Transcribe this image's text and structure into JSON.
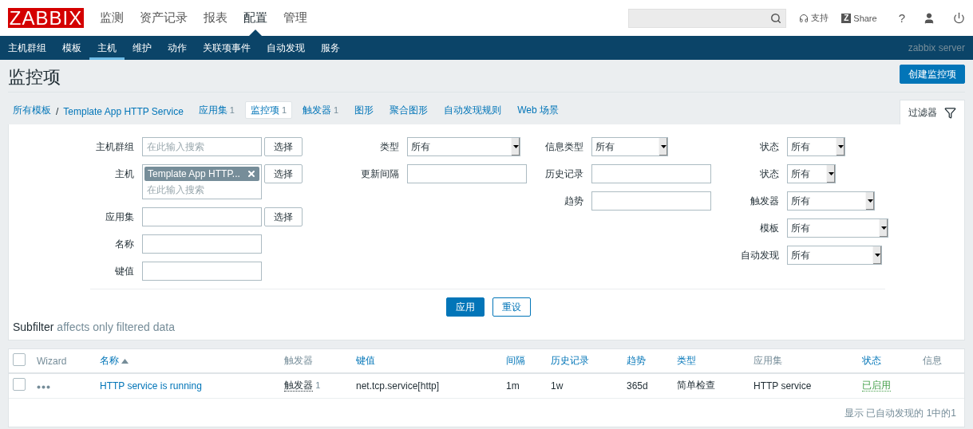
{
  "header": {
    "logo": "ZABBIX",
    "main_menu": [
      {
        "label": "监测",
        "selected": false
      },
      {
        "label": "资产记录",
        "selected": false
      },
      {
        "label": "报表",
        "selected": false
      },
      {
        "label": "配置",
        "selected": true
      },
      {
        "label": "管理",
        "selected": false
      }
    ],
    "support": "支持",
    "share": {
      "mark": "Z",
      "label": "Share"
    },
    "help": "?"
  },
  "sub_menu": {
    "items": [
      {
        "label": "主机群组",
        "selected": false
      },
      {
        "label": "模板",
        "selected": false
      },
      {
        "label": "主机",
        "selected": true
      },
      {
        "label": "维护",
        "selected": false
      },
      {
        "label": "动作",
        "selected": false
      },
      {
        "label": "关联项事件",
        "selected": false
      },
      {
        "label": "自动发现",
        "selected": false
      },
      {
        "label": "服务",
        "selected": false
      }
    ],
    "server": "zabbix server"
  },
  "page": {
    "title": "监控项",
    "create_button": "创建监控项"
  },
  "breadcrumbs": [
    "所有模板",
    "Template App HTTP Service"
  ],
  "breadcrumb_separator": "/",
  "tabs": [
    {
      "label": "应用集",
      "count": "1",
      "selected": false
    },
    {
      "label": "监控项",
      "count": "1",
      "selected": true
    },
    {
      "label": "触发器",
      "count": "1",
      "selected": false
    },
    {
      "label": "图形",
      "selected": false
    },
    {
      "label": "聚合图形",
      "selected": false
    },
    {
      "label": "自动发现规则",
      "selected": false
    },
    {
      "label": "Web 场景",
      "selected": false
    }
  ],
  "filter": {
    "tab": "过滤器",
    "columns": [
      [
        {
          "label": "主机群组",
          "kind": "multiselect",
          "placeholder": "在此输入搜索",
          "button": "选择"
        },
        {
          "label": "主机",
          "kind": "multiselect",
          "tags": [
            "Template App HTTP..."
          ],
          "placeholder": "在此输入搜索",
          "button": "选择"
        },
        {
          "label": "应用集",
          "kind": "text",
          "button": "选择"
        },
        {
          "label": "名称",
          "kind": "text"
        },
        {
          "label": "键值",
          "kind": "text"
        }
      ],
      [
        {
          "label": "类型",
          "kind": "select",
          "value": "所有"
        },
        {
          "label": "更新间隔",
          "kind": "text"
        }
      ],
      [
        {
          "label": "信息类型",
          "kind": "select",
          "value": "所有"
        },
        {
          "label": "历史记录",
          "kind": "text"
        },
        {
          "label": "趋势",
          "kind": "text"
        }
      ],
      [
        {
          "label": "状态",
          "kind": "select",
          "value": "所有"
        },
        {
          "label": "状态",
          "kind": "select",
          "value": "所有"
        },
        {
          "label": "触发器",
          "kind": "select",
          "value": "所有"
        },
        {
          "label": "模板",
          "kind": "select",
          "value": "所有"
        },
        {
          "label": "自动发现",
          "kind": "select",
          "value": "所有"
        }
      ]
    ],
    "apply": "应用",
    "reset": "重设",
    "subfilter": "Subfilter",
    "subfilter_note": "affects only filtered data"
  },
  "table": {
    "select_all_checked": false,
    "columns": [
      {
        "label": "Wizard",
        "sortable": false
      },
      {
        "label": "名称",
        "sortable": true,
        "sorted": true,
        "ascending": true
      },
      {
        "label": "触发器",
        "sortable": false
      },
      {
        "label": "键值",
        "sortable": true
      },
      {
        "label": "间隔",
        "sortable": true
      },
      {
        "label": "历史记录",
        "sortable": true
      },
      {
        "label": "趋势",
        "sortable": true
      },
      {
        "label": "类型",
        "sortable": true
      },
      {
        "label": "应用集",
        "sortable": false
      },
      {
        "label": "状态",
        "sortable": true
      },
      {
        "label": "信息",
        "sortable": false
      }
    ],
    "rows": [
      {
        "checked": false,
        "name": "HTTP service is running",
        "triggers": {
          "label": "触发器",
          "count": "1"
        },
        "key": "net.tcp.service[http]",
        "interval": "1m",
        "history": "1w",
        "trends": "365d",
        "type": "简单检查",
        "application": "HTTP service",
        "status": {
          "label": "已启用",
          "enabled": true
        }
      }
    ],
    "footer": "显示 已自动发现的 1中的1"
  }
}
